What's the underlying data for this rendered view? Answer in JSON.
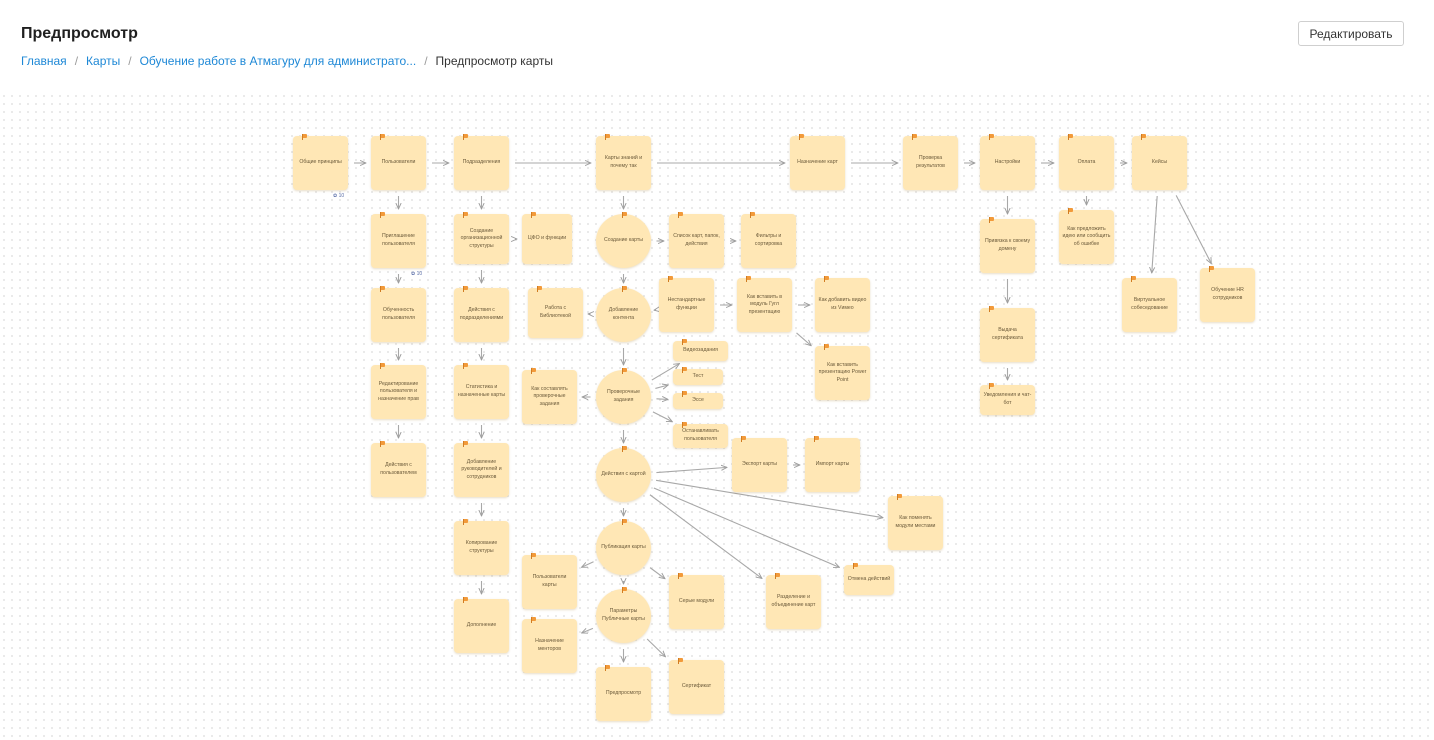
{
  "header": {
    "title": "Предпросмотр",
    "edit_label": "Редактировать"
  },
  "breadcrumb": {
    "items": [
      "Главная",
      "Карты",
      "Обучение работе в Атмагуру для администрато..."
    ],
    "current": "Предпросмотр карты"
  },
  "colors": {
    "node_fill": "#ffe7b5",
    "flag": "#f29a3a",
    "link": "#1e88d6",
    "edge": "#a8a8a8"
  },
  "diagram": {
    "nodes": [
      {
        "id": "general",
        "label": "Общие принципы",
        "shape": "rect",
        "badge": "✿ 10"
      },
      {
        "id": "users",
        "label": "Пользователи",
        "shape": "rect"
      },
      {
        "id": "divisions",
        "label": "Подразделения",
        "shape": "rect"
      },
      {
        "id": "maps_why",
        "label": "Карты знаний и почему так",
        "shape": "rect"
      },
      {
        "id": "assign_map",
        "label": "Назначение карт",
        "shape": "rect"
      },
      {
        "id": "check_results",
        "label": "Проверка результатов",
        "shape": "rect"
      },
      {
        "id": "settings",
        "label": "Настройки",
        "shape": "rect"
      },
      {
        "id": "payment",
        "label": "Оплата",
        "shape": "rect"
      },
      {
        "id": "cases",
        "label": "Кейсы",
        "shape": "rect"
      },
      {
        "id": "invite_users",
        "label": "Приглашение пользователя",
        "shape": "rect",
        "badge": "✿ 10"
      },
      {
        "id": "create_org",
        "label": "Создание организационной структуры",
        "shape": "rect"
      },
      {
        "id": "cfo",
        "label": "ЦФО и функции",
        "shape": "rect"
      },
      {
        "id": "create_map",
        "label": "Создание карты",
        "shape": "circle"
      },
      {
        "id": "list_maps",
        "label": "Список карт, папок, действия",
        "shape": "rect"
      },
      {
        "id": "filters",
        "label": "Фильтры и сортировка",
        "shape": "rect"
      },
      {
        "id": "bind_domain",
        "label": "Привязка к своему домену",
        "shape": "rect"
      },
      {
        "id": "suggest_idea",
        "label": "Как предложить идею или сообщить об ошибке",
        "shape": "rect"
      },
      {
        "id": "virtual_interview",
        "label": "Виртуальное собеседование",
        "shape": "rect"
      },
      {
        "id": "hr_training",
        "label": "Обучение HR сотрудников",
        "shape": "rect"
      },
      {
        "id": "user_training",
        "label": "Обученность пользователя",
        "shape": "rect"
      },
      {
        "id": "division_actions",
        "label": "Действия с подразделениями",
        "shape": "rect"
      },
      {
        "id": "library",
        "label": "Работа с Библиотекой",
        "shape": "rect"
      },
      {
        "id": "add_content",
        "label": "Добавление контента",
        "shape": "circle"
      },
      {
        "id": "custom_funcs",
        "label": "Нестандартные функции",
        "shape": "rect"
      },
      {
        "id": "insert_ppt",
        "label": "Как вставить в модуль Гугл презентацию",
        "shape": "rect"
      },
      {
        "id": "add_video",
        "label": "Как добавить видео из Vимео",
        "shape": "rect"
      },
      {
        "id": "insert_pp",
        "label": "Как вставить презентацию Power Point",
        "shape": "rect"
      },
      {
        "id": "issue_cert",
        "label": "Выдача сертификата",
        "shape": "rect"
      },
      {
        "id": "notify_bot",
        "label": "Уведомления и чат-бот",
        "shape": "rect"
      },
      {
        "id": "edit_user",
        "label": "Редактирование пользователя и назначение прав",
        "shape": "rect"
      },
      {
        "id": "stats",
        "label": "Статистика и назначенные карты",
        "shape": "rect"
      },
      {
        "id": "compose_tasks",
        "label": "Как составлять проверочные задания",
        "shape": "rect"
      },
      {
        "id": "check_tasks",
        "label": "Проверочные задания",
        "shape": "circle"
      },
      {
        "id": "video_task",
        "label": "Видеозадания",
        "shape": "rect"
      },
      {
        "id": "test",
        "label": "Тест",
        "shape": "rect"
      },
      {
        "id": "essay",
        "label": "Эссе",
        "shape": "rect"
      },
      {
        "id": "stop_users",
        "label": "Останавливать пользователя",
        "shape": "rect"
      },
      {
        "id": "user_actions",
        "label": "Действия с пользователем",
        "shape": "rect"
      },
      {
        "id": "add_managers",
        "label": "Добавление руководителей и сотрудников",
        "shape": "rect"
      },
      {
        "id": "map_actions",
        "label": "Действия с картой",
        "shape": "circle"
      },
      {
        "id": "export_map",
        "label": "Экспорт карты",
        "shape": "rect"
      },
      {
        "id": "import_map",
        "label": "Импорт карты",
        "shape": "rect"
      },
      {
        "id": "swap_modules",
        "label": "Как поменять модули местами",
        "shape": "rect"
      },
      {
        "id": "copy_struct",
        "label": "Копирование структуры",
        "shape": "rect"
      },
      {
        "id": "publish_map",
        "label": "Публикация карты",
        "shape": "circle"
      },
      {
        "id": "map_users",
        "label": "Пользователи карты",
        "shape": "rect"
      },
      {
        "id": "grey_modules",
        "label": "Серые модули",
        "shape": "rect"
      },
      {
        "id": "split_merge",
        "label": "Разделение и объединение карт",
        "shape": "rect"
      },
      {
        "id": "undo",
        "label": "Отмена действий",
        "shape": "rect"
      },
      {
        "id": "extra",
        "label": "Дополнение",
        "shape": "rect"
      },
      {
        "id": "public_params",
        "label": "Параметры Публичные карты",
        "shape": "circle"
      },
      {
        "id": "mentors",
        "label": "Назначение менторов",
        "shape": "rect"
      },
      {
        "id": "preview",
        "label": "Предпросмотр",
        "shape": "rect"
      },
      {
        "id": "certificate",
        "label": "Сертификат",
        "shape": "rect"
      }
    ],
    "edges": [
      [
        "general",
        "users"
      ],
      [
        "users",
        "divisions"
      ],
      [
        "divisions",
        "maps_why"
      ],
      [
        "maps_why",
        "assign_map"
      ],
      [
        "assign_map",
        "check_results"
      ],
      [
        "check_results",
        "settings"
      ],
      [
        "settings",
        "payment"
      ],
      [
        "payment",
        "cases"
      ],
      [
        "users",
        "invite_users"
      ],
      [
        "invite_users",
        "user_training"
      ],
      [
        "user_training",
        "edit_user"
      ],
      [
        "edit_user",
        "user_actions"
      ],
      [
        "divisions",
        "create_org"
      ],
      [
        "create_org",
        "cfo"
      ],
      [
        "create_org",
        "division_actions"
      ],
      [
        "division_actions",
        "stats"
      ],
      [
        "stats",
        "add_managers"
      ],
      [
        "add_managers",
        "copy_struct"
      ],
      [
        "copy_struct",
        "extra"
      ],
      [
        "maps_why",
        "create_map"
      ],
      [
        "create_map",
        "list_maps"
      ],
      [
        "list_maps",
        "filters"
      ],
      [
        "create_map",
        "add_content"
      ],
      [
        "add_content",
        "library"
      ],
      [
        "add_content",
        "custom_funcs"
      ],
      [
        "custom_funcs",
        "insert_ppt"
      ],
      [
        "insert_ppt",
        "add_video"
      ],
      [
        "insert_ppt",
        "insert_pp"
      ],
      [
        "add_content",
        "check_tasks"
      ],
      [
        "check_tasks",
        "compose_tasks"
      ],
      [
        "check_tasks",
        "video_task"
      ],
      [
        "check_tasks",
        "test"
      ],
      [
        "check_tasks",
        "essay"
      ],
      [
        "check_tasks",
        "stop_users"
      ],
      [
        "check_tasks",
        "map_actions"
      ],
      [
        "map_actions",
        "export_map"
      ],
      [
        "export_map",
        "import_map"
      ],
      [
        "map_actions",
        "swap_modules"
      ],
      [
        "map_actions",
        "undo"
      ],
      [
        "map_actions",
        "split_merge"
      ],
      [
        "map_actions",
        "publish_map"
      ],
      [
        "publish_map",
        "map_users"
      ],
      [
        "publish_map",
        "grey_modules"
      ],
      [
        "publish_map",
        "public_params"
      ],
      [
        "public_params",
        "mentors"
      ],
      [
        "public_params",
        "preview"
      ],
      [
        "public_params",
        "certificate"
      ],
      [
        "settings",
        "bind_domain"
      ],
      [
        "bind_domain",
        "issue_cert"
      ],
      [
        "issue_cert",
        "notify_bot"
      ],
      [
        "payment",
        "suggest_idea"
      ],
      [
        "cases",
        "virtual_interview"
      ],
      [
        "cases",
        "hr_training"
      ]
    ]
  }
}
